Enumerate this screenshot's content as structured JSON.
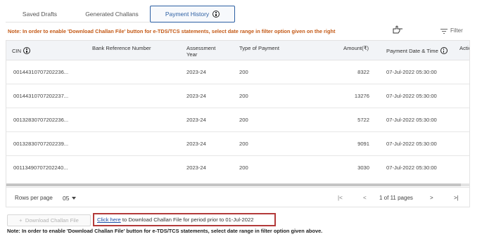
{
  "tabs": [
    {
      "label": "Saved Drafts"
    },
    {
      "label": "Generated Challans"
    },
    {
      "label": "Payment History",
      "active": true
    }
  ],
  "note_top": "Note: In order to enable 'Download Challan File' button for e-TDS/TCS statements, select date range in filter option given on the right",
  "filter_label": "Filter",
  "table": {
    "headers": {
      "cin": "CIN",
      "bank_ref": "Bank Reference Number",
      "assessment_year_1": "Assessment",
      "assessment_year_2": "Year",
      "type_of_payment": "Type of Payment",
      "amount": "Amount(₹)",
      "payment_date": "Payment Date & Time",
      "action": "Action"
    },
    "rows": [
      {
        "cin": "00144310707202236...",
        "bank_ref": "",
        "year": "2023-24",
        "type": "200",
        "amount": "8322",
        "date": "07-Jul-2022 05:30:00"
      },
      {
        "cin": "00144310707202237...",
        "bank_ref": "",
        "year": "2023-24",
        "type": "200",
        "amount": "13276",
        "date": "07-Jul-2022 05:30:00"
      },
      {
        "cin": "00132830707202236...",
        "bank_ref": "",
        "year": "2023-24",
        "type": "200",
        "amount": "5722",
        "date": "07-Jul-2022 05:30:00"
      },
      {
        "cin": "00132830707202239...",
        "bank_ref": "",
        "year": "2023-24",
        "type": "200",
        "amount": "9091",
        "date": "07-Jul-2022 05:30:00"
      },
      {
        "cin": "00113490707202240...",
        "bank_ref": "",
        "year": "2023-24",
        "type": "200",
        "amount": "3030",
        "date": "07-Jul-2022 05:30:00"
      }
    ]
  },
  "pagination": {
    "rows_per_page_label": "Rows per page",
    "rows_per_page_value": "05",
    "page_info": "1 of 11 pages",
    "first_symbol": "|<",
    "prev_symbol": "<",
    "next_symbol": ">",
    "last_symbol": ">|"
  },
  "download_button": {
    "label": "Download Challan File",
    "plus": "+"
  },
  "click_here": {
    "link": "Click here",
    "text": " to Download Challan File for period prior to 01-Jul-2022"
  },
  "note_bottom": "Note: In order to enable 'Download Challan File' button for e-TDS/TCS statements, select date range in filter option given above.",
  "icons": {
    "info": "info-icon",
    "hand": "hand-pointer-icon",
    "filter": "filter-icon",
    "dropdown": "caret-down-icon"
  },
  "colors": {
    "accent": "#2c5fa3",
    "note": "#c45a17",
    "highlight_border": "#b33a3a",
    "link": "#1f4fa8"
  }
}
